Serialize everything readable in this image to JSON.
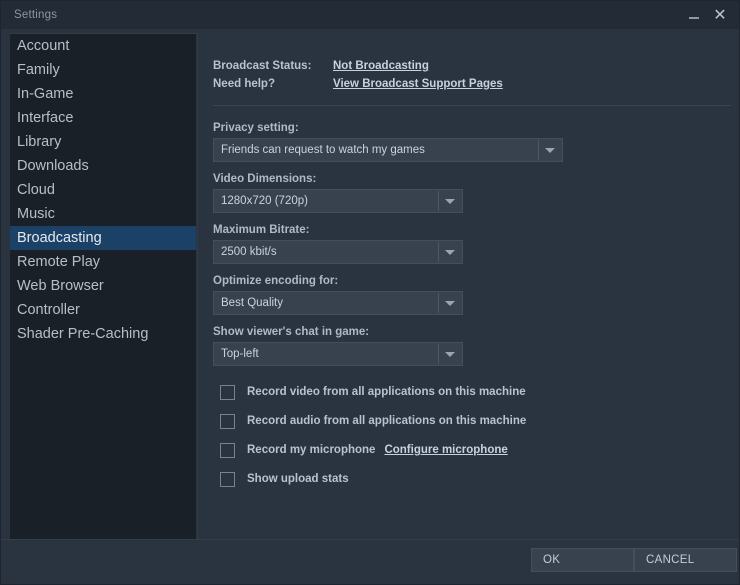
{
  "window": {
    "title": "Settings",
    "minimize_icon": "minimize-icon",
    "close_icon": "close-icon"
  },
  "sidebar": {
    "items": [
      {
        "label": "Account",
        "selected": false
      },
      {
        "label": "Family",
        "selected": false
      },
      {
        "label": "In-Game",
        "selected": false
      },
      {
        "label": "Interface",
        "selected": false
      },
      {
        "label": "Library",
        "selected": false
      },
      {
        "label": "Downloads",
        "selected": false
      },
      {
        "label": "Cloud",
        "selected": false
      },
      {
        "label": "Music",
        "selected": false
      },
      {
        "label": "Broadcasting",
        "selected": true
      },
      {
        "label": "Remote Play",
        "selected": false
      },
      {
        "label": "Web Browser",
        "selected": false
      },
      {
        "label": "Controller",
        "selected": false
      },
      {
        "label": "Shader Pre-Caching",
        "selected": false
      }
    ]
  },
  "main": {
    "status": {
      "broadcast_status_label": "Broadcast Status:",
      "broadcast_status_value": "Not Broadcasting",
      "need_help_label": "Need help?",
      "support_link": "View Broadcast Support Pages"
    },
    "fields": {
      "privacy": {
        "label": "Privacy setting:",
        "value": "Friends can request to watch my games"
      },
      "video_dimensions": {
        "label": "Video Dimensions:",
        "value": "1280x720 (720p)"
      },
      "maximum_bitrate": {
        "label": "Maximum Bitrate:",
        "value": "2500 kbit/s"
      },
      "optimize_encoding": {
        "label": "Optimize encoding for:",
        "value": "Best Quality"
      },
      "chat_position": {
        "label": "Show viewer's chat in game:",
        "value": "Top-left"
      }
    },
    "checkboxes": [
      {
        "label": "Record video from all applications on this machine",
        "checked": false
      },
      {
        "label": "Record audio from all applications on this machine",
        "checked": false
      },
      {
        "label": "Record my microphone",
        "checked": false,
        "link": "Configure microphone"
      },
      {
        "label": "Show upload stats",
        "checked": false
      }
    ]
  },
  "footer": {
    "ok_label": "OK",
    "cancel_label": "CANCEL"
  },
  "colors": {
    "window_background": "#2a3440",
    "titlebar": "#222b36",
    "sidebar_background": "#1a2028",
    "selected_item": "#1b4266",
    "control_background": "#38424e",
    "text_primary": "#c9d3dd",
    "text_secondary": "#b9c3cd"
  }
}
